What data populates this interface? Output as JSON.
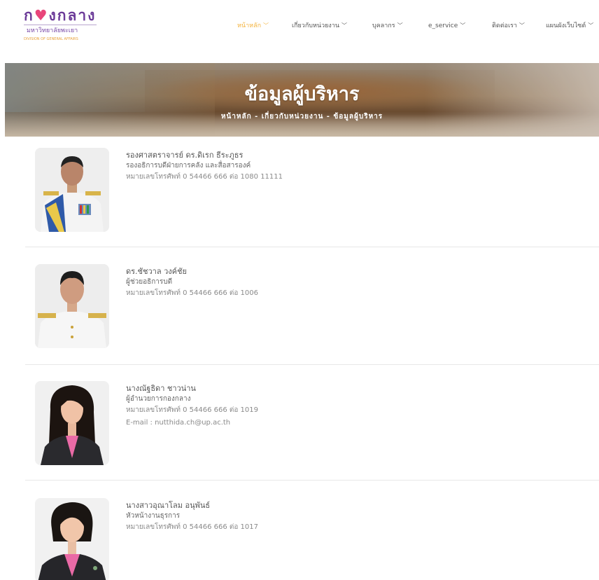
{
  "logo": {
    "title": "กองกลาง",
    "subtitle": "มหาวิทยาลัยพะเยา",
    "english": "DIVISION OF GENERAL AFFAIRS"
  },
  "nav": {
    "items": [
      {
        "label": "หน้าหลัก",
        "active": true
      },
      {
        "label": "เกี่ยวกับหน่วยงาน",
        "active": false
      },
      {
        "label": "บุคลากร",
        "active": false
      },
      {
        "label": "e_service",
        "active": false
      },
      {
        "label": "ติดต่อเรา",
        "active": false
      },
      {
        "label": "แผนผังเว็บไซต์",
        "active": false
      }
    ]
  },
  "banner": {
    "title": "ข้อมูลผู้บริหาร",
    "breadcrumb": "หน้าหลัก - เกี่ยวกับหน่วยงาน - ข้อมูลผู้บริหาร"
  },
  "executives": [
    {
      "name": "รองศาสตราจารย์ ดร.ดิเรก ธีระภูธร",
      "position": "รองอธิการบดีฝ่ายการคลัง และสื่อสารองค์",
      "phone": "หมายเลขโทรศัพท์ 0 54466 666 ต่อ 1080 11111"
    },
    {
      "name": "ดร.ชัชวาล วงค์ชัย",
      "position": "ผู้ช่วยอธิการบดี",
      "phone": "หมายเลขโทรศัพท์ 0 54466 666 ต่อ 1006"
    },
    {
      "name": "นางณัฐธิดา ชาวน่าน",
      "position": "ผู้อำนวยการกองกลาง",
      "phone": "หมายเลขโทรศัพท์ 0 54466 666 ต่อ 1019",
      "email": "E-mail : nutthida.ch@up.ac.th"
    },
    {
      "name": "นางสาวอุณาโลม อนุพันธ์",
      "position": "หัวหน้างานธุรการ",
      "phone": "หมายเลขโทรศัพท์ 0 54466 666 ต่อ 1017"
    }
  ],
  "colors": {
    "brand_purple": "#6b3a98",
    "brand_pink": "#e8457a",
    "nav_active": "#f3b33d"
  },
  "icons": {
    "nav_dropdown": "chevron-down-icon",
    "logo_heart": "heart-icon"
  }
}
